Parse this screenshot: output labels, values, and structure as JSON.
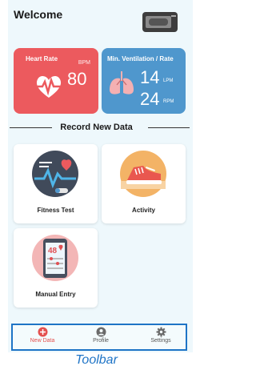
{
  "header": {
    "title": "Welcome",
    "device_icon": "wearable-device-icon"
  },
  "heart_rate": {
    "title": "Heart Rate",
    "unit": "BPM",
    "value": "80",
    "icon": "heart-pulse-icon"
  },
  "ventilation": {
    "title": "Min. Ventilation / Rate",
    "value1": "14",
    "unit1": "LPM",
    "value2": "24",
    "unit2": "RPM",
    "icon": "lungs-icon"
  },
  "section": {
    "title": "Record New Data"
  },
  "tiles": [
    {
      "label": "Fitness Test",
      "icon": "fitness-test-icon"
    },
    {
      "label": "Activity",
      "icon": "running-shoe-icon"
    },
    {
      "label": "Manual Entry",
      "icon": "phone-manual-entry-icon",
      "screen_value": "48"
    }
  ],
  "toolbar": {
    "items": [
      {
        "label": "New Data",
        "icon": "plus-circle-icon",
        "active": true
      },
      {
        "label": "Profile",
        "icon": "profile-icon",
        "active": false
      },
      {
        "label": "Settings",
        "icon": "gear-icon",
        "active": false
      }
    ],
    "caption": "Toolbar"
  },
  "colors": {
    "heart_card": "#ec5a5e",
    "vent_card": "#4f97cd",
    "accent": "#e4504f",
    "toolbar_border": "#1e74c6"
  }
}
